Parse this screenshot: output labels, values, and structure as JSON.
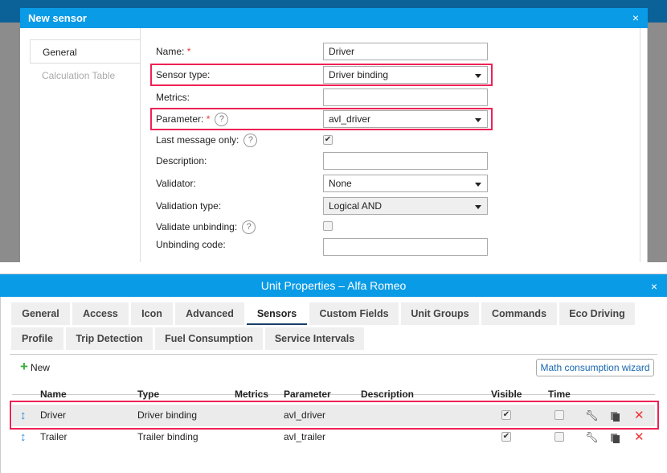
{
  "dialog": {
    "title": "New sensor",
    "close_icon": "close-icon",
    "side_tabs": [
      {
        "label": "General",
        "active": true
      },
      {
        "label": "Calculation Table",
        "active": false
      }
    ],
    "fields": {
      "name": {
        "label": "Name:",
        "required": "*",
        "value": "Driver"
      },
      "sensor_type": {
        "label": "Sensor type:",
        "value": "Driver binding"
      },
      "metrics": {
        "label": "Metrics:",
        "value": ""
      },
      "parameter": {
        "label": "Parameter:",
        "required": "*",
        "value": "avl_driver"
      },
      "last_message_only": {
        "label": "Last message only:",
        "checked": true
      },
      "description": {
        "label": "Description:",
        "value": ""
      },
      "validator": {
        "label": "Validator:",
        "value": "None"
      },
      "validation_type": {
        "label": "Validation type:",
        "value": "Logical AND"
      },
      "validate_unbinding": {
        "label": "Validate unbinding:",
        "checked": false
      },
      "unbinding_code": {
        "label": "Unbinding code:",
        "value": ""
      }
    },
    "help_glyph": "?"
  },
  "window": {
    "title": "Unit Properties – Alfa Romeo",
    "close": "×",
    "tabs": [
      "General",
      "Access",
      "Icon",
      "Advanced",
      "Sensors",
      "Custom Fields",
      "Unit Groups",
      "Commands",
      "Eco Driving",
      "Profile",
      "Trip Detection",
      "Fuel Consumption",
      "Service Intervals"
    ],
    "active_tab": "Sensors",
    "new_label": "New",
    "wizard_label": "Math consumption wizard",
    "columns": [
      "Name",
      "Type",
      "Metrics",
      "Parameter",
      "Description",
      "Visible",
      "Time"
    ],
    "rows": [
      {
        "name": "Driver",
        "type": "Driver binding",
        "metrics": "",
        "parameter": "avl_driver",
        "description": "",
        "visible": true,
        "time": false,
        "highlighted": true
      },
      {
        "name": "Trailer",
        "type": "Trailer binding",
        "metrics": "",
        "parameter": "avl_trailer",
        "description": "",
        "visible": true,
        "time": false,
        "highlighted": false
      }
    ]
  },
  "colors": {
    "title_bar": "#0a9be6",
    "highlight": "#ee2255",
    "delete": "#ee3333",
    "add": "#3cad3c"
  }
}
